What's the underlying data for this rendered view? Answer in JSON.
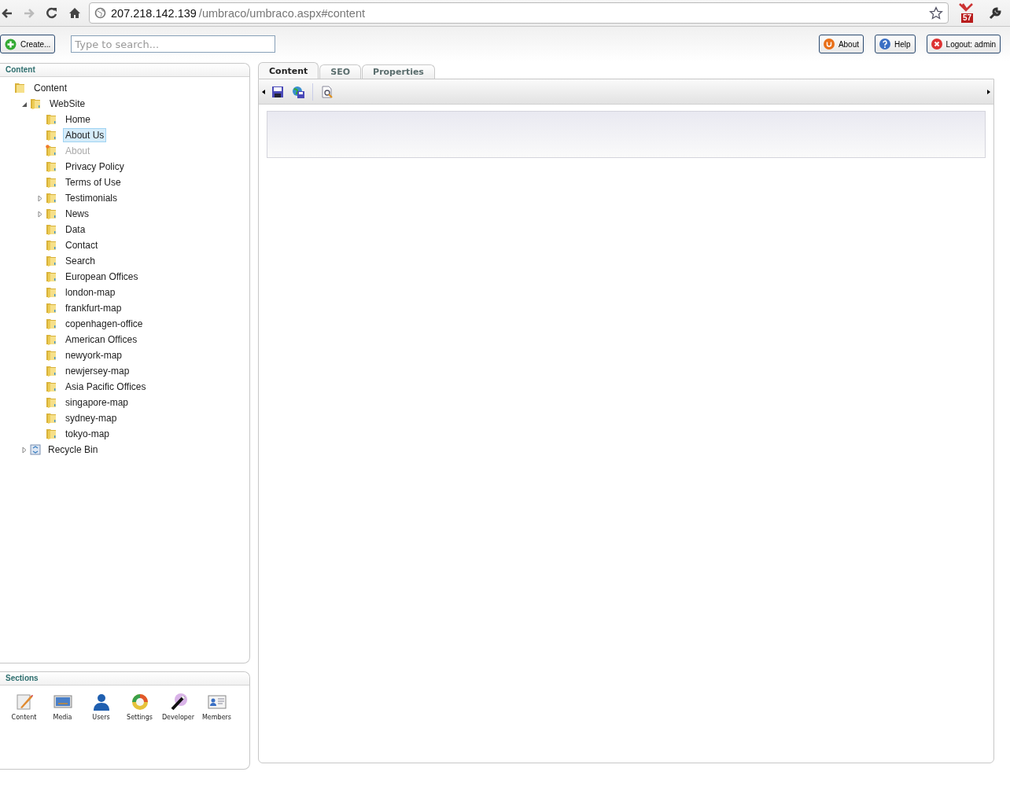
{
  "browser": {
    "url_host": "207.218.142.139",
    "url_path": "/umbraco/umbraco.aspx#content",
    "extension_badge": "57"
  },
  "toolbar": {
    "create_button": "Create...",
    "search": {
      "placeholder": "Type to search..."
    },
    "buttons": [
      {
        "kind": "about",
        "label": "About"
      },
      {
        "kind": "help",
        "label": "Help"
      },
      {
        "kind": "logout",
        "label": "Logout: admin"
      }
    ]
  },
  "tree_panel": {
    "title": "Content",
    "tree": [
      {
        "label": "Content",
        "kind": "root",
        "selected": false,
        "children": [
          {
            "label": "WebSite",
            "kind": "folder",
            "expanded": true,
            "published": true,
            "selected": false,
            "children": [
              {
                "label": "Home",
                "kind": "folder",
                "published": true,
                "selected": false
              },
              {
                "label": "About Us",
                "kind": "folder",
                "published": true,
                "selected": true
              },
              {
                "label": "About",
                "kind": "folder",
                "published": false,
                "selected": false
              },
              {
                "label": "Privacy Policy",
                "kind": "folder",
                "published": true,
                "selected": false
              },
              {
                "label": "Terms of Use",
                "kind": "folder",
                "published": true,
                "selected": false
              },
              {
                "label": "Testimonials",
                "kind": "folder",
                "expanded": false,
                "published": true,
                "selected": false
              },
              {
                "label": "News",
                "kind": "folder",
                "expanded": false,
                "published": true,
                "selected": false
              },
              {
                "label": "Data",
                "kind": "folder",
                "published": true,
                "selected": false
              },
              {
                "label": "Contact",
                "kind": "folder",
                "published": true,
                "selected": false
              },
              {
                "label": "Search",
                "kind": "folder",
                "published": true,
                "selected": false
              },
              {
                "label": "European Offices",
                "kind": "folder",
                "published": true,
                "selected": false
              },
              {
                "label": "london-map",
                "kind": "folder",
                "published": true,
                "selected": false
              },
              {
                "label": "frankfurt-map",
                "kind": "folder",
                "published": true,
                "selected": false
              },
              {
                "label": "copenhagen-office",
                "kind": "folder",
                "published": true,
                "selected": false
              },
              {
                "label": "American Offices",
                "kind": "folder",
                "published": true,
                "selected": false
              },
              {
                "label": "newyork-map",
                "kind": "folder",
                "published": true,
                "selected": false
              },
              {
                "label": "newjersey-map",
                "kind": "folder",
                "published": true,
                "selected": false
              },
              {
                "label": "Asia Pacific Offices",
                "kind": "folder",
                "published": true,
                "selected": false
              },
              {
                "label": "singapore-map",
                "kind": "folder",
                "published": true,
                "selected": false
              },
              {
                "label": "sydney-map",
                "kind": "folder",
                "published": true,
                "selected": false
              },
              {
                "label": "tokyo-map",
                "kind": "folder",
                "published": true,
                "selected": false
              }
            ]
          },
          {
            "label": "Recycle Bin",
            "kind": "recycle",
            "expanded": false,
            "selected": false
          }
        ]
      }
    ]
  },
  "sections_panel": {
    "title": "Sections",
    "sections": [
      {
        "kind": "content",
        "label": "Content"
      },
      {
        "kind": "media",
        "label": "Media"
      },
      {
        "kind": "users",
        "label": "Users"
      },
      {
        "kind": "settings",
        "label": "Settings"
      },
      {
        "kind": "developer",
        "label": "Developer"
      },
      {
        "kind": "members",
        "label": "Members"
      }
    ]
  },
  "editor": {
    "tabs": [
      {
        "label": "Content",
        "selected": true
      },
      {
        "label": "SEO",
        "selected": false
      },
      {
        "label": "Properties",
        "selected": false
      }
    ],
    "tools": [
      {
        "kind": "save"
      },
      {
        "kind": "publish"
      },
      {
        "kind": "separator"
      },
      {
        "kind": "preview"
      }
    ]
  }
}
